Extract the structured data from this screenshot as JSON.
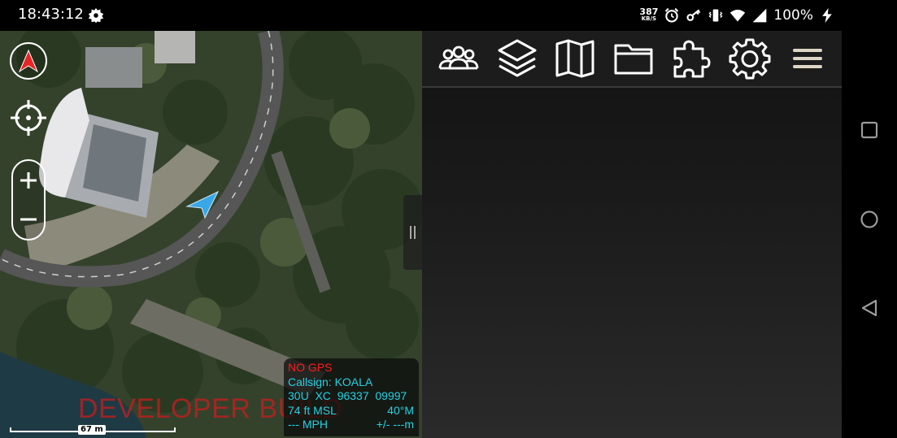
{
  "status_bar": {
    "time": "18:43:12",
    "net_speed_value": "387",
    "net_speed_unit": "KB/S",
    "battery_percent": "100%",
    "icons": [
      "settings-gear-icon",
      "alarm-icon",
      "vpn-key-icon",
      "vibrate-icon",
      "wifi-icon",
      "cell-signal-icon",
      "charging-icon"
    ]
  },
  "map": {
    "watermark": "DEVELOPER BUILD",
    "scale_label": "67 m",
    "controls": [
      "compass-icon",
      "locate-crosshair-icon",
      "zoom-in-icon",
      "zoom-out-icon"
    ],
    "zoom_in_label": "+",
    "zoom_out_label": "−"
  },
  "info_box": {
    "gps_status": "NO GPS",
    "callsign": "Callsign: KOALA",
    "mgrs": "30U  XC  96337  09997",
    "altitude": "74 ft MSL",
    "heading": "40°M",
    "speed": "--- MPH",
    "accuracy": "+/- ---m"
  },
  "toolbar": {
    "buttons": [
      "contacts-icon",
      "layers-icon",
      "maps-icon",
      "folder-icon",
      "plugins-icon",
      "settings-icon",
      "menu-icon"
    ]
  },
  "nav_bar": {
    "buttons": [
      "recents-icon",
      "home-icon",
      "back-icon"
    ]
  },
  "colors": {
    "gps_error": "#ff1d1d",
    "info_text": "#21d3e6",
    "self_marker": "#3aa7e6",
    "compass_arrow": "#e62525",
    "watermark": "#c81e1e"
  }
}
